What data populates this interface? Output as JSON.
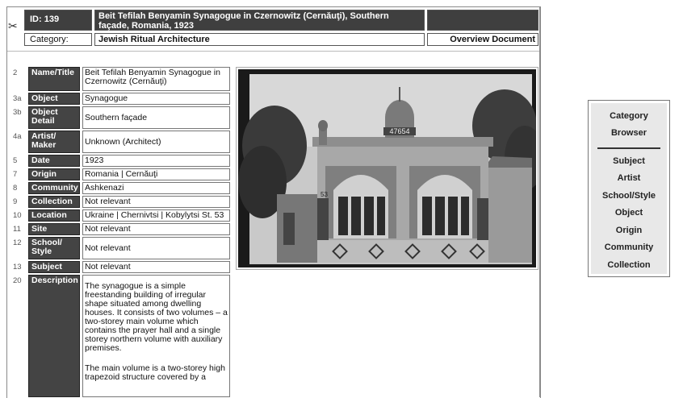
{
  "header": {
    "icon": "scissors-icon",
    "id_label": "ID: 139",
    "title": "Beit Tefilah Benyamin Synagogue in Czernowitz (Cernăuţi), Southern façade, Romania, 1923",
    "category_label": "Category:",
    "category_value": "Jewish Ritual Architecture",
    "overview_link": "Overview Document"
  },
  "fields": [
    {
      "num": "2",
      "label": "Name/Title",
      "value": "Beit Tefilah Benyamin Synagogue in Czernowitz (Cernăuţi)"
    },
    {
      "num": "3a",
      "label": "Object",
      "value": "Synagogue"
    },
    {
      "num": "3b",
      "label": "Object Detail",
      "value": "Southern façade"
    },
    {
      "num": "4a",
      "label": "Artist/ Maker",
      "value": "Unknown (Architect)"
    },
    {
      "num": "5",
      "label": "Date",
      "value": "1923"
    },
    {
      "num": "7",
      "label": "Origin",
      "value": "Romania | Cernăuţi"
    },
    {
      "num": "8",
      "label": "Community",
      "value": "Ashkenazi"
    },
    {
      "num": "9",
      "label": "Collection",
      "value": "Not relevant"
    },
    {
      "num": "10",
      "label": "Location",
      "value": "Ukraine | Chernivtsi | Kobylytsi St. 53"
    },
    {
      "num": "11",
      "label": "Site",
      "value": "Not relevant"
    },
    {
      "num": "12",
      "label": "School/ Style",
      "value": "Not relevant"
    },
    {
      "num": "13",
      "label": "Subject",
      "value": "Not relevant"
    },
    {
      "num": "20",
      "label": "Description",
      "value_p1": "The synagogue is a simple freestanding building of irregular shape situated among dwelling houses.  It consists of two volumes – a two-storey main volume which contains the prayer hall and a single storey northern volume with auxiliary premises.",
      "value_p2": "The main volume is a two-storey high trapezoid structure covered by a"
    }
  ],
  "photo": {
    "sign_text": "47654",
    "door_number": "53"
  },
  "browser": {
    "title_line1": "Category",
    "title_line2": "Browser",
    "items": [
      "Subject",
      "Artist",
      "School/Style",
      "Object",
      "Origin",
      "Community",
      "Collection"
    ]
  }
}
